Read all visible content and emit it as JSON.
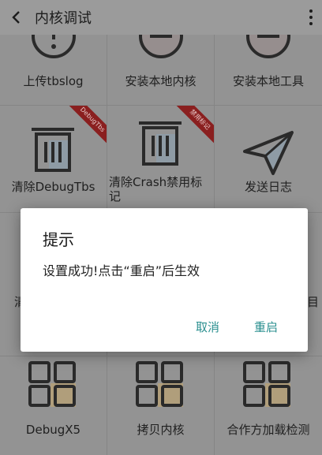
{
  "toolbar": {
    "title": "内核调试"
  },
  "grid": {
    "rows": [
      [
        {
          "label": "上传tbslog",
          "icon": "warning-circle-icon"
        },
        {
          "label": "安装本地内核",
          "icon": "no-entry-circle-icon"
        },
        {
          "label": "安装本地工具",
          "icon": "no-entry-circle-icon"
        }
      ],
      [
        {
          "label": "清除DebugTbs",
          "icon": "trash-icon",
          "badge": "DebugTbs"
        },
        {
          "label": "清除Crash禁用标记",
          "icon": "trash-icon",
          "badge": "禁用标记"
        },
        {
          "label": "发送日志",
          "icon": "paper-plane-icon"
        }
      ],
      [
        {
          "label": "清",
          "icon": ""
        },
        {
          "label": "",
          "icon": ""
        },
        {
          "label": "目",
          "icon": ""
        }
      ],
      [
        {
          "label": "DebugX5",
          "icon": "grid-icon"
        },
        {
          "label": "拷贝内核",
          "icon": "grid-icon"
        },
        {
          "label": "合作方加载检测",
          "icon": "grid-icon"
        }
      ]
    ]
  },
  "dialog": {
    "title": "提示",
    "message": "设置成功!点击“重启”后生效",
    "cancel": "取消",
    "confirm": "重启"
  }
}
